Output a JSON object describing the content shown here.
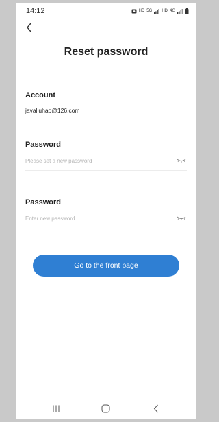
{
  "status_bar": {
    "time": "14:12",
    "icons": [
      "notification-icon",
      "hd-icon",
      "5g-icon",
      "signal-icon",
      "hd-icon",
      "4g-icon",
      "signal-icon",
      "battery-icon"
    ],
    "hd_label": "HD",
    "net_5g": "5G",
    "net_4g": "4G"
  },
  "header": {
    "back_icon": "chevron-left-icon",
    "title": "Reset password"
  },
  "form": {
    "account": {
      "label": "Account",
      "value": "javalluhao@126.com"
    },
    "new_password": {
      "label": "Password",
      "placeholder": "Please set a new password",
      "toggle_icon": "eye-closed-icon"
    },
    "confirm_password": {
      "label": "Password",
      "placeholder": "Enter new password",
      "toggle_icon": "eye-closed-icon"
    }
  },
  "submit": {
    "label": "Go to the front page"
  },
  "nav_bar": {
    "recents_icon": "recents-icon",
    "home_icon": "home-icon",
    "back_icon": "back-icon"
  },
  "colors": {
    "primary": "#2f7fd3",
    "placeholder": "#b5b5b5",
    "divider": "#ececec"
  }
}
